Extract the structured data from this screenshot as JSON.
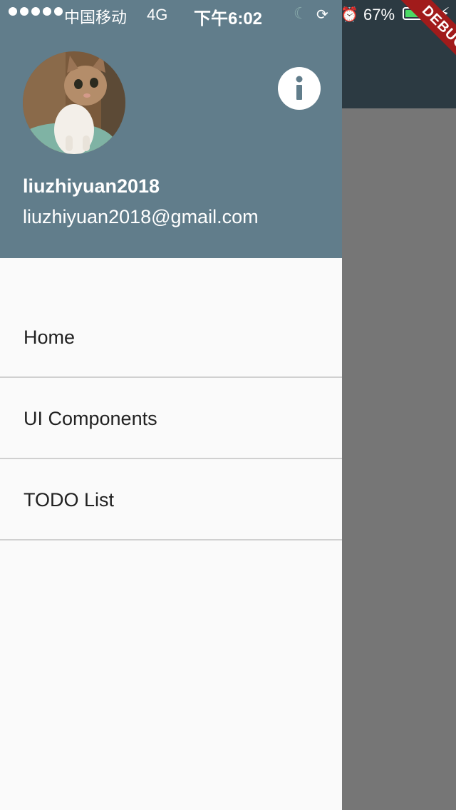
{
  "status_bar": {
    "carrier": "中国移动",
    "network": "4G",
    "time": "下午6:02",
    "battery_percent_text": "67%",
    "battery_level": 0.67
  },
  "debug_banner": "DEBUG",
  "drawer": {
    "account_name": "liuzhiyuan2018",
    "account_email": "liuzhiyuan2018@gmail.com",
    "header_color": "#617d8b",
    "menu_items": [
      {
        "label": "Home"
      },
      {
        "label": "UI Components"
      },
      {
        "label": "TODO List"
      }
    ]
  },
  "icons": {
    "info": "info-icon",
    "avatar": "cat-avatar"
  }
}
